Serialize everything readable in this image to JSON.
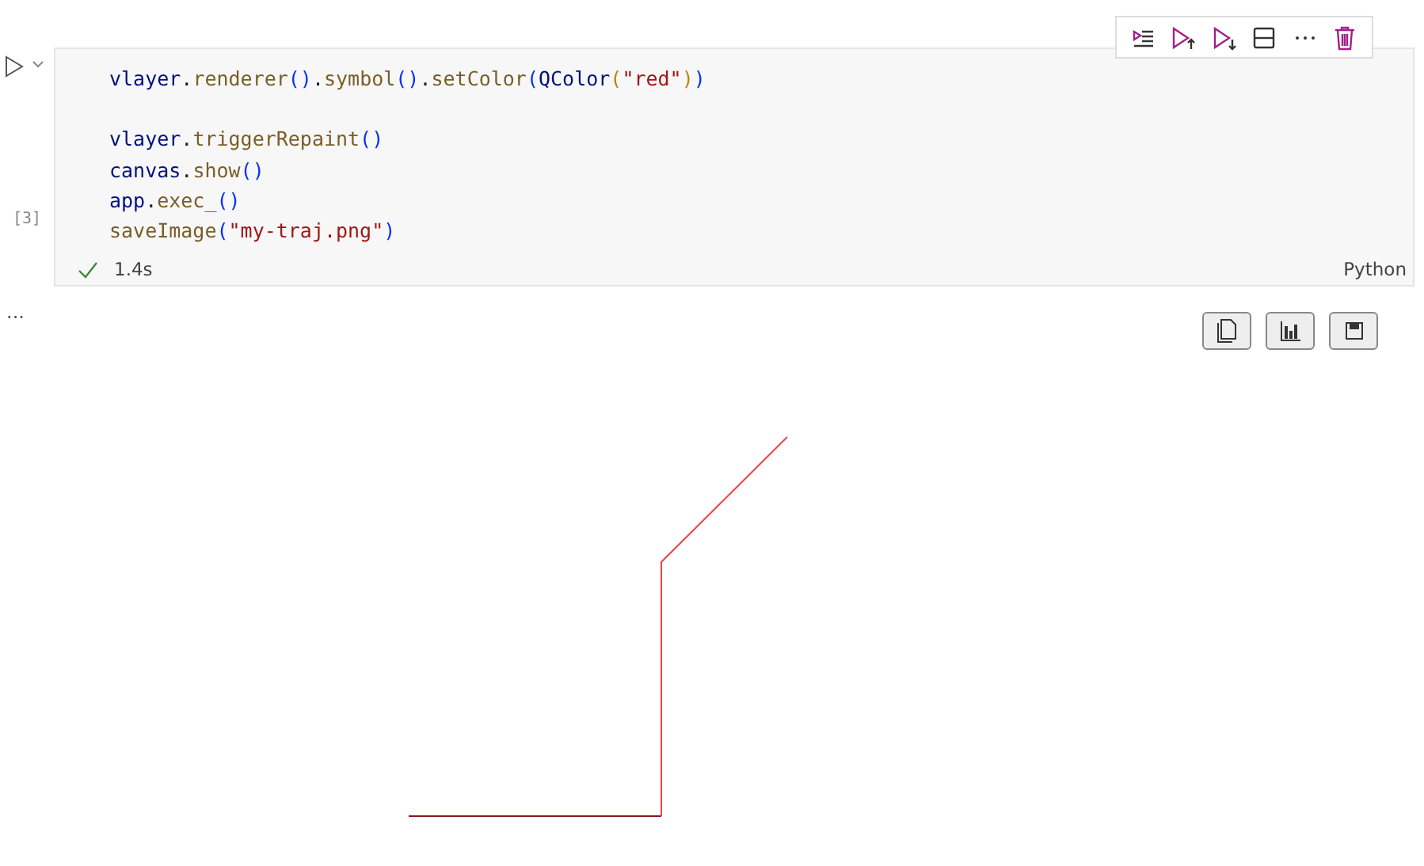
{
  "cell": {
    "execution_count": "[3]",
    "duration": "1.4s",
    "succeeded": true,
    "language": "Python",
    "lines": [
      {
        "kind": "code",
        "tokens": [
          {
            "kind": "var",
            "text": "vlayer"
          },
          {
            "kind": "plain",
            "text": "."
          },
          {
            "kind": "func",
            "text": "renderer"
          },
          {
            "kind": "bracket1",
            "text": "()"
          },
          {
            "kind": "plain",
            "text": "."
          },
          {
            "kind": "func",
            "text": "symbol"
          },
          {
            "kind": "bracket1",
            "text": "()"
          },
          {
            "kind": "plain",
            "text": "."
          },
          {
            "kind": "func",
            "text": "setColor"
          },
          {
            "kind": "bracket1",
            "text": "("
          },
          {
            "kind": "var",
            "text": "QColor"
          },
          {
            "kind": "bracket2",
            "text": "("
          },
          {
            "kind": "string",
            "text": "\"red\""
          },
          {
            "kind": "bracket2",
            "text": ")"
          },
          {
            "kind": "bracket1",
            "text": ")"
          }
        ]
      },
      {
        "kind": "blank"
      },
      {
        "kind": "code",
        "tokens": [
          {
            "kind": "var",
            "text": "vlayer"
          },
          {
            "kind": "plain",
            "text": "."
          },
          {
            "kind": "func",
            "text": "triggerRepaint"
          },
          {
            "kind": "bracket1",
            "text": "()"
          }
        ]
      },
      {
        "kind": "code",
        "tokens": [
          {
            "kind": "var",
            "text": "canvas"
          },
          {
            "kind": "plain",
            "text": "."
          },
          {
            "kind": "func",
            "text": "show"
          },
          {
            "kind": "bracket1",
            "text": "()"
          }
        ]
      },
      {
        "kind": "code",
        "tokens": [
          {
            "kind": "var",
            "text": "app"
          },
          {
            "kind": "plain",
            "text": "."
          },
          {
            "kind": "func",
            "text": "exec_"
          },
          {
            "kind": "bracket1",
            "text": "()"
          }
        ]
      },
      {
        "kind": "code",
        "tokens": [
          {
            "kind": "func",
            "text": "saveImage"
          },
          {
            "kind": "bracket1",
            "text": "("
          },
          {
            "kind": "string",
            "text": "\"my-traj.png\""
          },
          {
            "kind": "bracket1",
            "text": ")"
          }
        ]
      }
    ]
  },
  "output": {
    "more": "..."
  }
}
